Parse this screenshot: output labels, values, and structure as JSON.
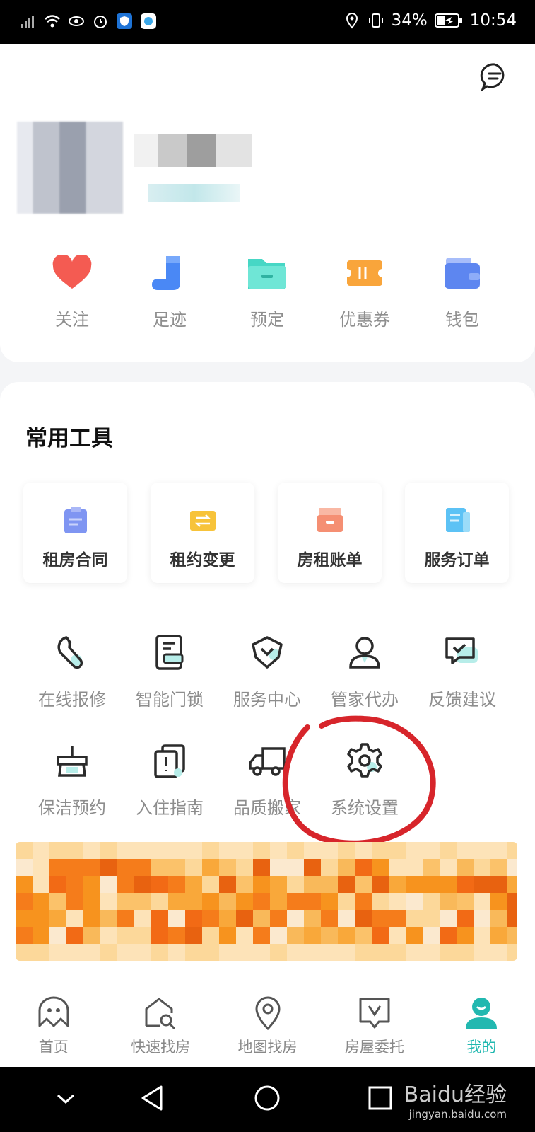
{
  "status_bar": {
    "battery": "34%",
    "time": "10:54"
  },
  "quick_items": [
    {
      "label": "关注",
      "icon": "heart-icon"
    },
    {
      "label": "足迹",
      "icon": "footprint-icon"
    },
    {
      "label": "预定",
      "icon": "folder-icon"
    },
    {
      "label": "优惠券",
      "icon": "coupon-icon"
    },
    {
      "label": "钱包",
      "icon": "wallet-icon"
    }
  ],
  "tools": {
    "title": "常用工具",
    "tiles": [
      {
        "label": "租房合同",
        "icon": "contract-icon",
        "color": "#7f95f2"
      },
      {
        "label": "租约变更",
        "icon": "lease-change-icon",
        "color": "#f7c33a"
      },
      {
        "label": "房租账单",
        "icon": "bill-icon",
        "color": "#f58f73"
      },
      {
        "label": "服务订单",
        "icon": "order-icon",
        "color": "#5cc2f5"
      }
    ],
    "grid": [
      {
        "label": "在线报修",
        "icon": "repair-icon"
      },
      {
        "label": "智能门锁",
        "icon": "door-lock-icon"
      },
      {
        "label": "服务中心",
        "icon": "service-center-icon"
      },
      {
        "label": "管家代办",
        "icon": "butler-icon"
      },
      {
        "label": "反馈建议",
        "icon": "feedback-icon"
      },
      {
        "label": "保洁预约",
        "icon": "cleaning-icon"
      },
      {
        "label": "入住指南",
        "icon": "guide-icon"
      },
      {
        "label": "品质搬家",
        "icon": "moving-truck-icon"
      },
      {
        "label": "系统设置",
        "icon": "gear-icon"
      }
    ]
  },
  "tabs": [
    {
      "label": "首页",
      "icon": "home-icon",
      "active": false
    },
    {
      "label": "快速找房",
      "icon": "house-search-icon",
      "active": false
    },
    {
      "label": "地图找房",
      "icon": "map-pin-icon",
      "active": false
    },
    {
      "label": "房屋委托",
      "icon": "entrust-icon",
      "active": false
    },
    {
      "label": "我的",
      "icon": "profile-icon",
      "active": true
    }
  ],
  "watermark": {
    "brand": "Baidu经验",
    "url": "jingyan.baidu.com"
  },
  "colors": {
    "accent": "#22b8b0",
    "annotation": "#d7252b"
  }
}
